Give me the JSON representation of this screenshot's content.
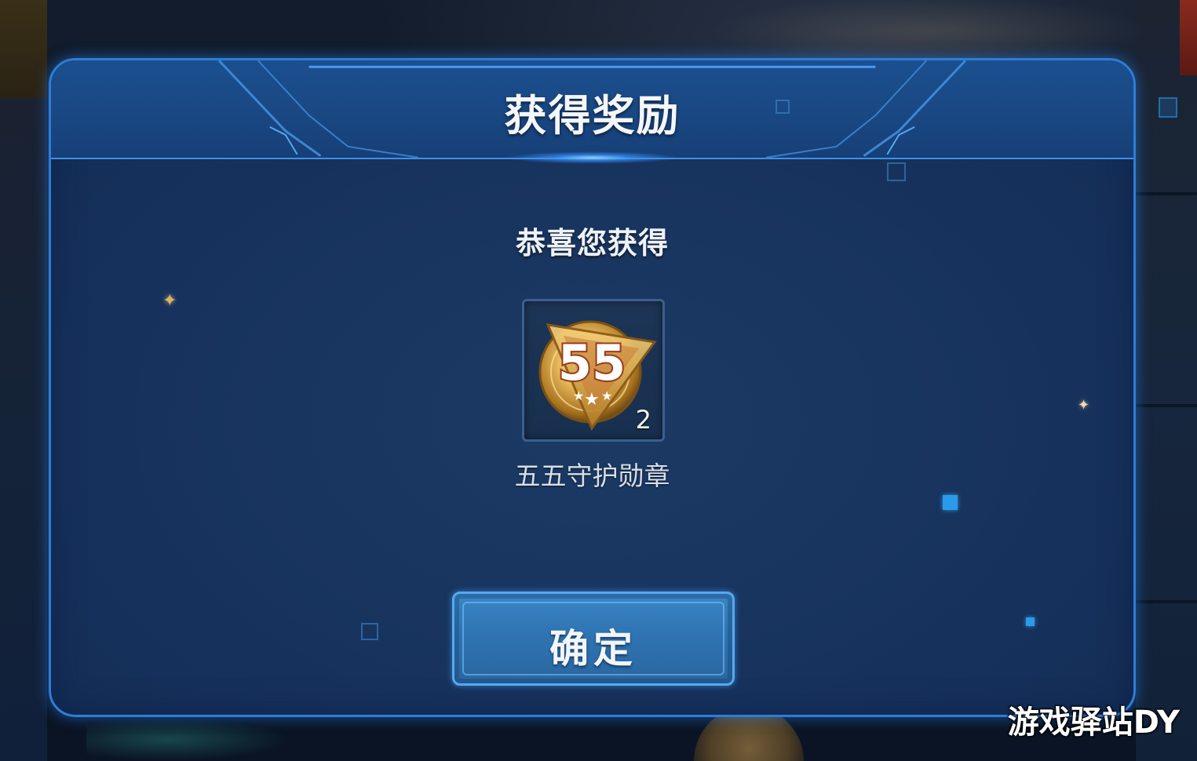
{
  "dialog": {
    "title": "获得奖励",
    "subtitle": "恭喜您获得"
  },
  "reward": {
    "icon": "medal-55-icon",
    "badge_text": "55",
    "count": "2",
    "name": "五五守护勋章"
  },
  "actions": {
    "confirm_label": "确定"
  },
  "watermark": "游戏驿站DY",
  "colors": {
    "accent": "#2f7dd6",
    "panel": "#183560",
    "button": "#3a86c6",
    "medal_gold": "#e0b25a"
  }
}
